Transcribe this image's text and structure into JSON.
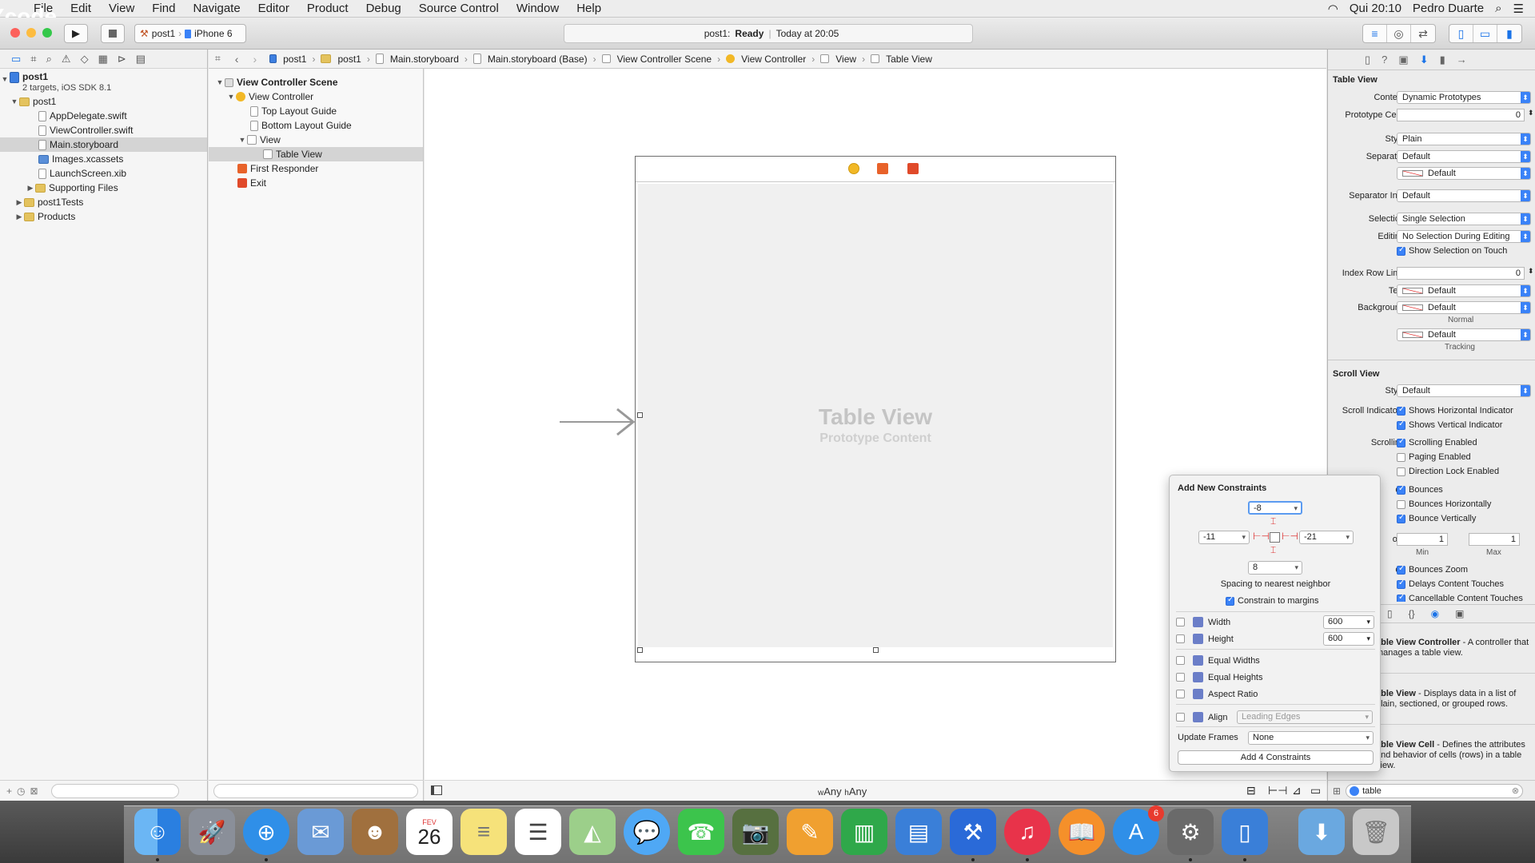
{
  "menubar": {
    "app": "Xcode",
    "items": [
      "File",
      "Edit",
      "View",
      "Find",
      "Navigate",
      "Editor",
      "Product",
      "Debug",
      "Source Control",
      "Window",
      "Help"
    ],
    "clock": "Qui 20:10",
    "user": "Pedro Duarte"
  },
  "toolbar": {
    "scheme": "post1",
    "device": "iPhone 6",
    "status_project": "post1:",
    "status_state": "Ready",
    "status_time": "Today at 20:05"
  },
  "navigator": {
    "items": [
      {
        "label": "post1",
        "sub": "2 targets, iOS SDK 8.1"
      },
      {
        "label": "post1"
      },
      {
        "label": "AppDelegate.swift"
      },
      {
        "label": "ViewController.swift"
      },
      {
        "label": "Main.storyboard"
      },
      {
        "label": "Images.xcassets"
      },
      {
        "label": "LaunchScreen.xib"
      },
      {
        "label": "Supporting Files"
      },
      {
        "label": "post1Tests"
      },
      {
        "label": "Products"
      }
    ]
  },
  "jumpbar": {
    "crumbs": [
      "post1",
      "post1",
      "Main.storyboard",
      "Main.storyboard (Base)",
      "View Controller Scene",
      "View Controller",
      "View",
      "Table View"
    ]
  },
  "outline": {
    "items": [
      "View Controller Scene",
      "View Controller",
      "Top Layout Guide",
      "Bottom Layout Guide",
      "View",
      "Table View",
      "First Responder",
      "Exit"
    ]
  },
  "canvas": {
    "placeholder_title": "Table View",
    "placeholder_sub": "Prototype Content",
    "size_w_prefix": "w",
    "size_w": "Any",
    "size_h_prefix": "h",
    "size_h": "Any"
  },
  "inspector": {
    "table_view": {
      "header": "Table View",
      "content_label": "Content",
      "content": "Dynamic Prototypes",
      "prototype_label": "Prototype Cells",
      "prototype": "0",
      "style_label": "Style",
      "style": "Plain",
      "separator_label": "Separator",
      "separator": "Default",
      "separator_color": "Default",
      "separator_inset_label": "Separator In...",
      "separator_inset": "Default",
      "selection_label": "Selection",
      "selection": "Single Selection",
      "editing_label": "Editing",
      "editing": "No Selection During Editing",
      "show_selection": "Show Selection on Touch",
      "index_limit_label": "Index Row Limit",
      "index_limit": "0",
      "text_label": "Text",
      "text": "Default",
      "background_label": "Background",
      "background": "Default",
      "normal_label": "Normal",
      "tracking_color": "Default",
      "tracking_label": "Tracking"
    },
    "scroll_view": {
      "header": "Scroll View",
      "style_label": "Style",
      "style": "Default",
      "indicators_label": "Scroll Indicators",
      "horizontal": "Shows Horizontal Indicator",
      "vertical": "Shows Vertical Indicator",
      "scrolling_label": "Scrolling",
      "scroll_enabled": "Scrolling Enabled",
      "paging": "Paging Enabled",
      "direction_lock": "Direction Lock Enabled",
      "bounce_label_fragment": "ce",
      "bounces": "Bounces",
      "bounce_h": "Bounces Horizontally",
      "bounce_v": "Bounce Vertically",
      "zoom_label_fragment": "om",
      "zoom_min": "1",
      "zoom_max": "1",
      "min_label": "Min",
      "max_label": "Max",
      "touch_label_fragment": "ch",
      "bounces_zoom": "Bounces Zoom",
      "delays": "Delays Content Touches",
      "cancellable": "Cancellable Content Touches"
    },
    "library": [
      {
        "title": "able View Controller",
        "desc": " - A controller that manages a table view."
      },
      {
        "title": "able View",
        "desc": " - Displays data in a list of plain, sectioned, or grouped rows."
      },
      {
        "title": "able View Cell",
        "desc": " - Defines the attributes and behavior of cells (rows) in a table view."
      }
    ],
    "search": "table"
  },
  "constraints": {
    "title": "Add New Constraints",
    "top": "-8",
    "left": "-11",
    "right": "-21",
    "bottom": "8",
    "spacing_label": "Spacing to nearest neighbor",
    "margins_label": "Constrain to margins",
    "width_label": "Width",
    "width": "600",
    "height_label": "Height",
    "height": "600",
    "equal_widths": "Equal Widths",
    "equal_heights": "Equal Heights",
    "aspect_ratio": "Aspect Ratio",
    "align_label": "Align",
    "align": "Leading Edges",
    "update_label": "Update Frames",
    "update": "None",
    "add_button": "Add 4 Constraints"
  },
  "dock": {
    "calendar_month": "FEV",
    "calendar_day": "26",
    "appstore_badge": "6"
  },
  "colors": {
    "accent": "#1a73e8",
    "close": "#fc605b",
    "minimize": "#fdbc40",
    "zoom": "#34c84a",
    "constraint": "#d33333"
  }
}
